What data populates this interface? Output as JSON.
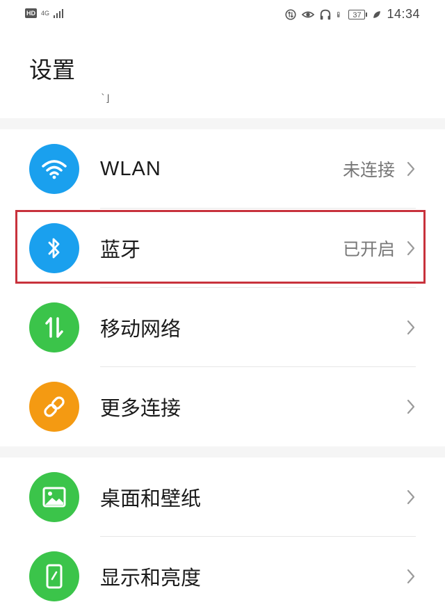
{
  "status_bar": {
    "hd": "HD",
    "network": "4G",
    "battery": "37",
    "time": "14:34",
    "icons": [
      "hd-badge",
      "4g-signal-icon",
      "sync-icon",
      "eye-comfort-icon",
      "headphones-icon",
      "battery-icon",
      "leaf-icon"
    ]
  },
  "header": {
    "title": "设置",
    "scroll_hint": "ˋ⌋"
  },
  "section1": {
    "items": [
      {
        "label": "WLAN",
        "value": "未连接",
        "icon": "wifi-icon",
        "color": "#1aa0ee"
      },
      {
        "label": "蓝牙",
        "value": "已开启",
        "icon": "bluetooth-icon",
        "color": "#1aa0ee"
      },
      {
        "label": "移动网络",
        "value": "",
        "icon": "mobile-data-icon",
        "color": "#3bc44a"
      },
      {
        "label": "更多连接",
        "value": "",
        "icon": "link-icon",
        "color": "#f49a12"
      }
    ]
  },
  "section2": {
    "items": [
      {
        "label": "桌面和壁纸",
        "value": "",
        "icon": "wallpaper-icon",
        "color": "#3bc44a"
      },
      {
        "label": "显示和亮度",
        "value": "",
        "icon": "display-icon",
        "color": "#3bc44a"
      }
    ]
  },
  "colors": {
    "highlight": "#c8323c",
    "band": "#f5f5f5"
  }
}
